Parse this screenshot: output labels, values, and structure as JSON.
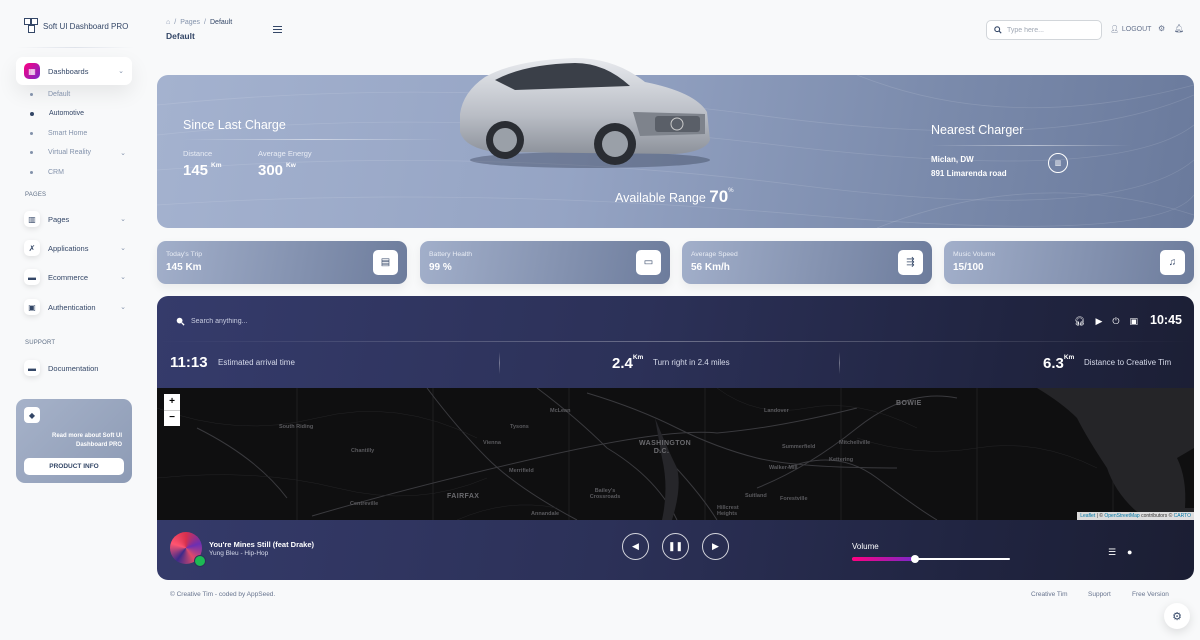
{
  "brand": {
    "name": "Soft UI Dashboard PRO"
  },
  "sidebar": {
    "dashboards_label": "Dashboards",
    "sub_items": [
      {
        "label": "Default",
        "active": false
      },
      {
        "label": "Automotive",
        "active": true
      },
      {
        "label": "Smart Home",
        "active": false
      },
      {
        "label": "Virtual Reality",
        "active": false,
        "has_children": true
      },
      {
        "label": "CRM",
        "active": false
      }
    ],
    "pages_section": "PAGES",
    "pages_items": [
      {
        "label": "Pages",
        "icon": "office-icon"
      },
      {
        "label": "Applications",
        "icon": "tools-icon"
      },
      {
        "label": "Ecommerce",
        "icon": "basket-icon"
      },
      {
        "label": "Authentication",
        "icon": "document-icon"
      }
    ],
    "support_section": "SUPPORT",
    "support_items": [
      {
        "label": "Documentation",
        "icon": "spaceship-icon"
      }
    ],
    "promo": {
      "text": "Read more about Soft UI Dashboard PRO",
      "button": "PRODUCT INFO"
    }
  },
  "navbar": {
    "breadcrumb": [
      "Pages",
      "Default"
    ],
    "title": "Default",
    "search_placeholder": "Type here...",
    "logout": "LOGOUT"
  },
  "hero": {
    "since_title": "Since Last Charge",
    "distance_label": "Distance",
    "distance_value": "145",
    "distance_unit": "Km",
    "energy_label": "Average Energy",
    "energy_value": "300",
    "energy_unit": "Kw",
    "range_label": "Available Range",
    "range_value": "70",
    "range_unit": "%",
    "charger_title": "Nearest Charger",
    "charger_city": "Miclan, DW",
    "charger_address": "891 Limarenda road"
  },
  "stats": [
    {
      "label": "Today's Trip",
      "value": "145 Km",
      "icon": "map-icon"
    },
    {
      "label": "Battery Health",
      "value": "99 %",
      "icon": "battery-icon"
    },
    {
      "label": "Average Speed",
      "value": "56 Km/h",
      "icon": "speed-icon"
    },
    {
      "label": "Music Volume",
      "value": "15/100",
      "icon": "music-note-icon"
    }
  ],
  "navigation": {
    "search_placeholder": "Search anything...",
    "clock": "10:45",
    "arrival_time": "11:13",
    "arrival_label": "Estimated arrival time",
    "turn_distance": "2.4",
    "turn_unit": "Km",
    "turn_label": "Turn right in 2.4 miles",
    "destination_distance": "6.3",
    "destination_unit": "Km",
    "destination_label": "Distance to Creative Tim",
    "map": {
      "zoom_in": "+",
      "zoom_out": "−",
      "labels": [
        "South Riding",
        "Chantilly",
        "Centreville",
        "Tysons",
        "McLean",
        "Vienna",
        "Merrifield",
        "FAIRFAX",
        "Annandale",
        "Bailey's Crossroads",
        "WASHINGTON D.C.",
        "Landover",
        "BOWIE",
        "Summerfield",
        "Mitchellville",
        "Kettering",
        "Walker Mill",
        "Suitland",
        "Forestville",
        "Hillcrest Heights"
      ],
      "attribution_leaflet": "Leaflet",
      "attribution_osm": "OpenStreetMap",
      "attribution_mid": " | © ",
      "attribution_rest": " contributors © ",
      "attribution_carto": "CARTO"
    },
    "player": {
      "title": "You're Mines Still (feat Drake)",
      "subtitle": "Yung Bleu - Hip-Hop",
      "volume_label": "Volume",
      "volume_percent": 40
    }
  },
  "footer": {
    "copyright": "© Creative Tim - coded by AppSeed.",
    "links": [
      "Creative Tim",
      "Support",
      "Free Version"
    ]
  },
  "colors": {
    "accent_gradient_start": "#7928ca",
    "accent_gradient_end": "#ff0080",
    "text_primary": "#344767",
    "text_secondary": "#8392ab"
  }
}
